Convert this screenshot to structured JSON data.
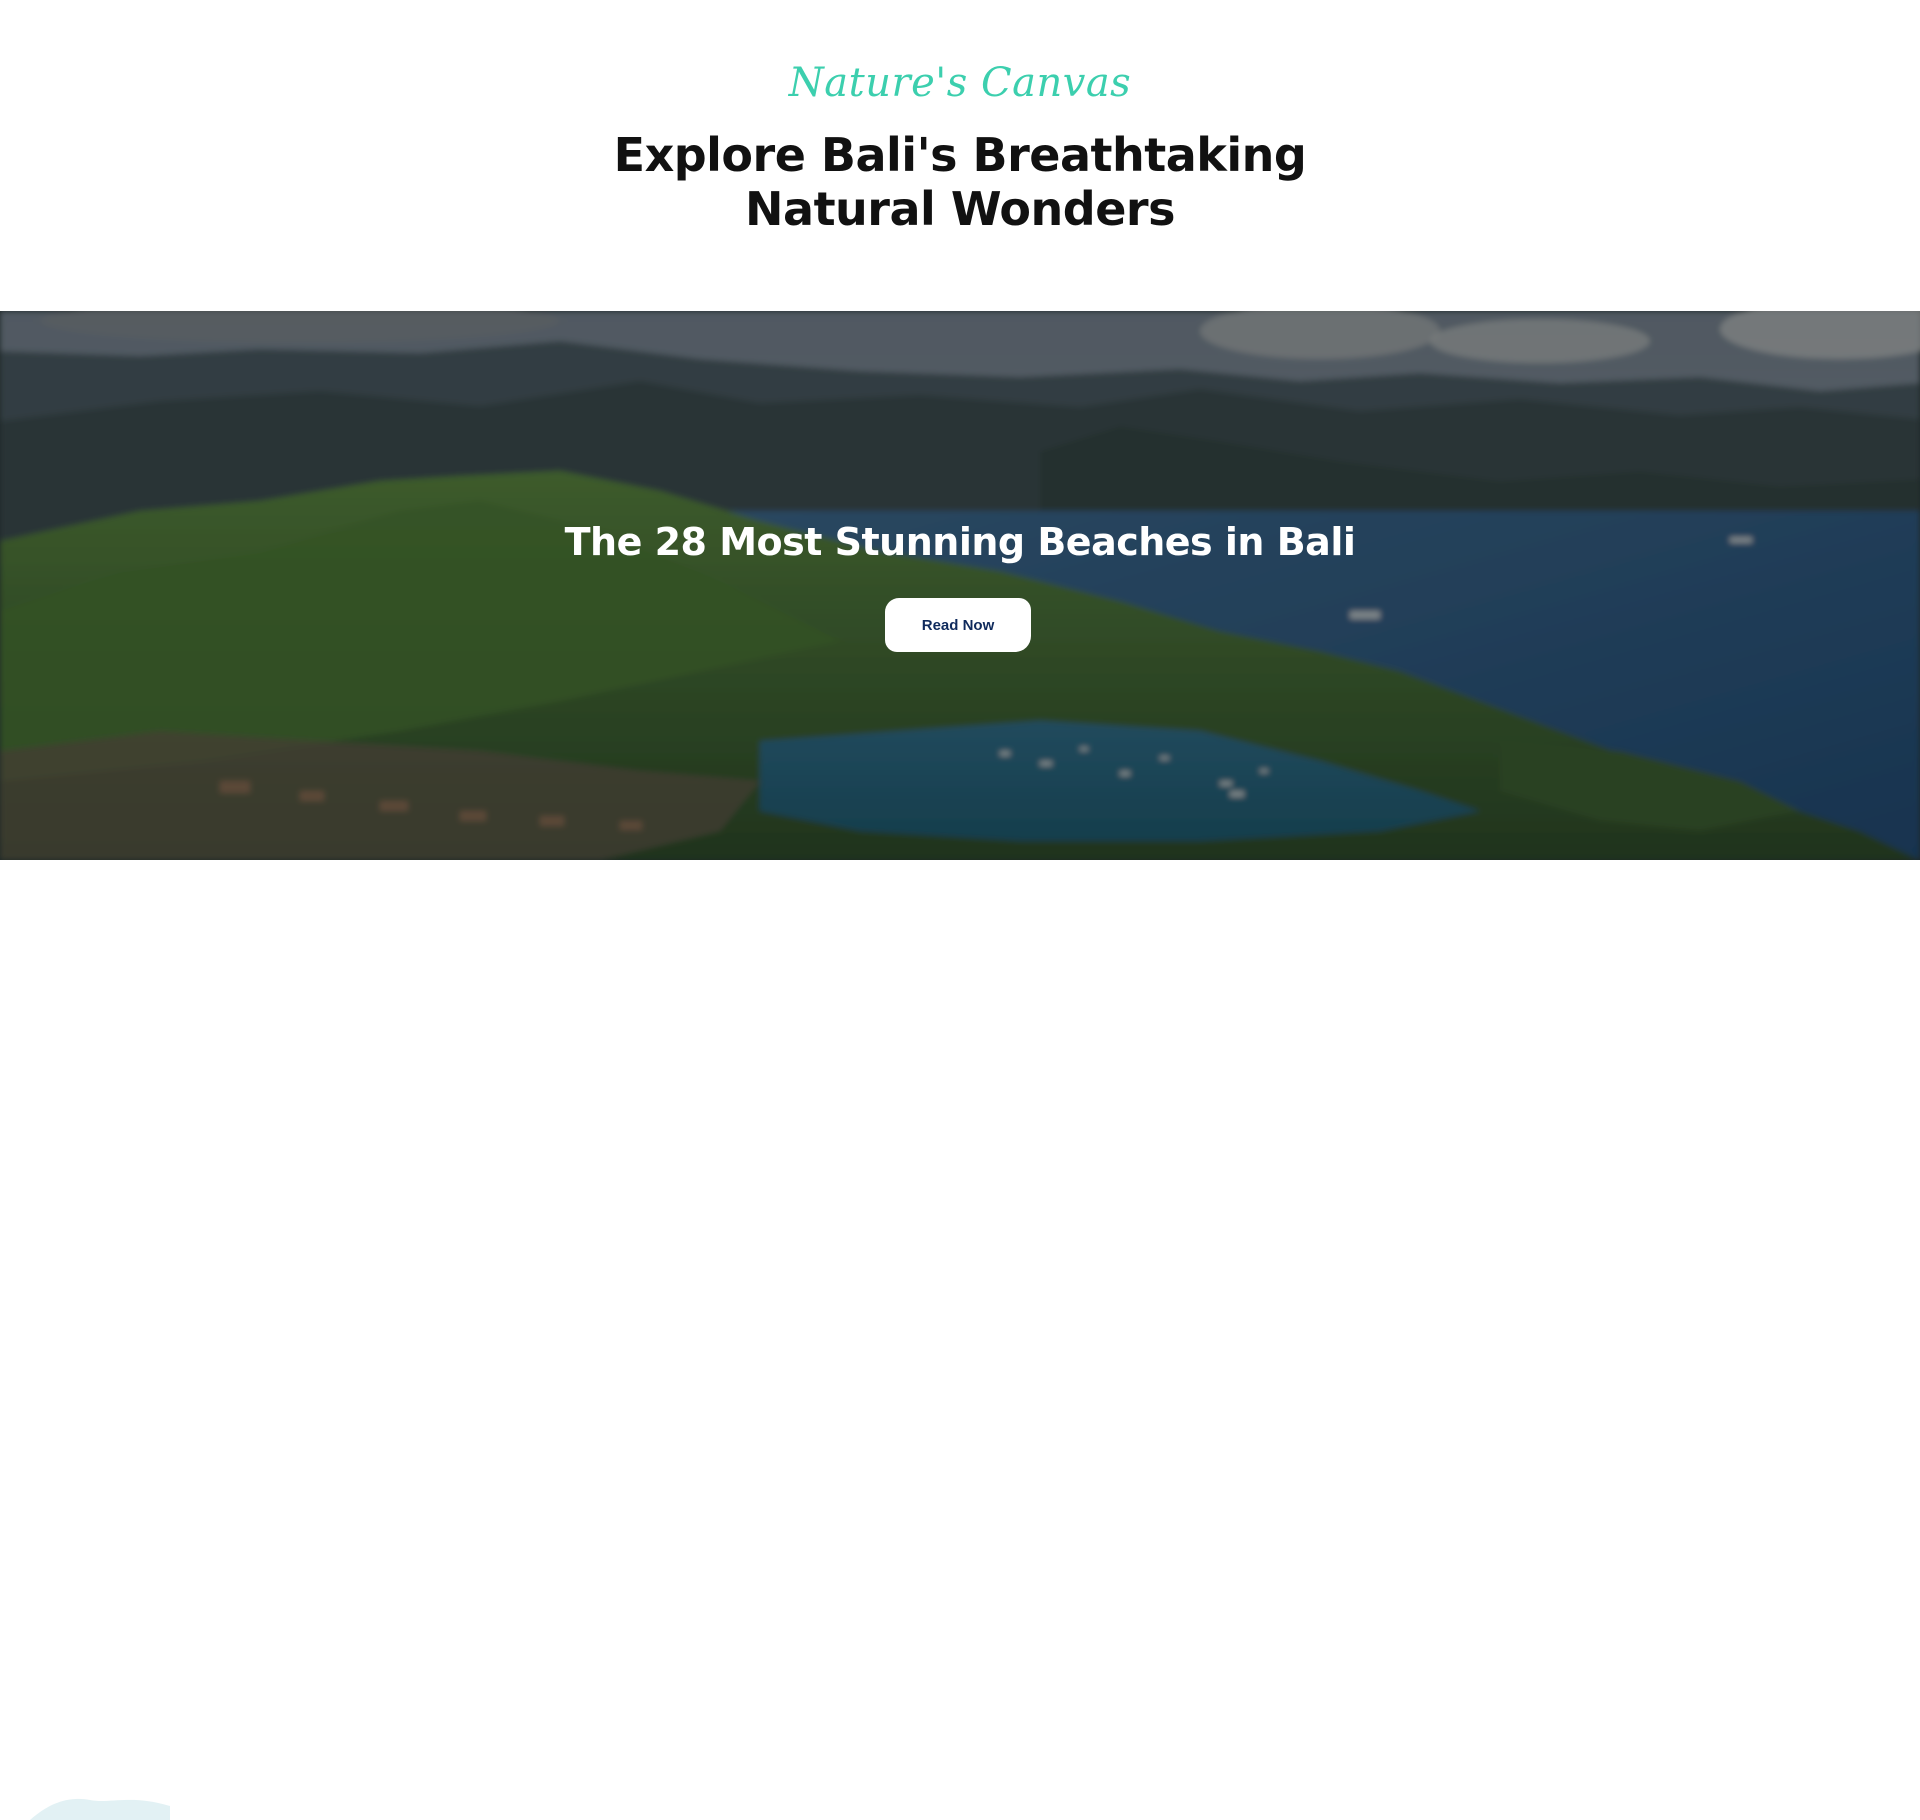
{
  "intro": {
    "eyebrow": "Nature's Canvas",
    "headline": "Explore Bali's Breathtaking Natural Wonders"
  },
  "hero": {
    "title": "The 28 Most Stunning Beaches in Bali",
    "button_label": "Read Now"
  },
  "colors": {
    "eyebrow": "#3ccfae",
    "headline": "#111111",
    "button_text": "#0f2a5c",
    "button_bg": "#ffffff"
  }
}
